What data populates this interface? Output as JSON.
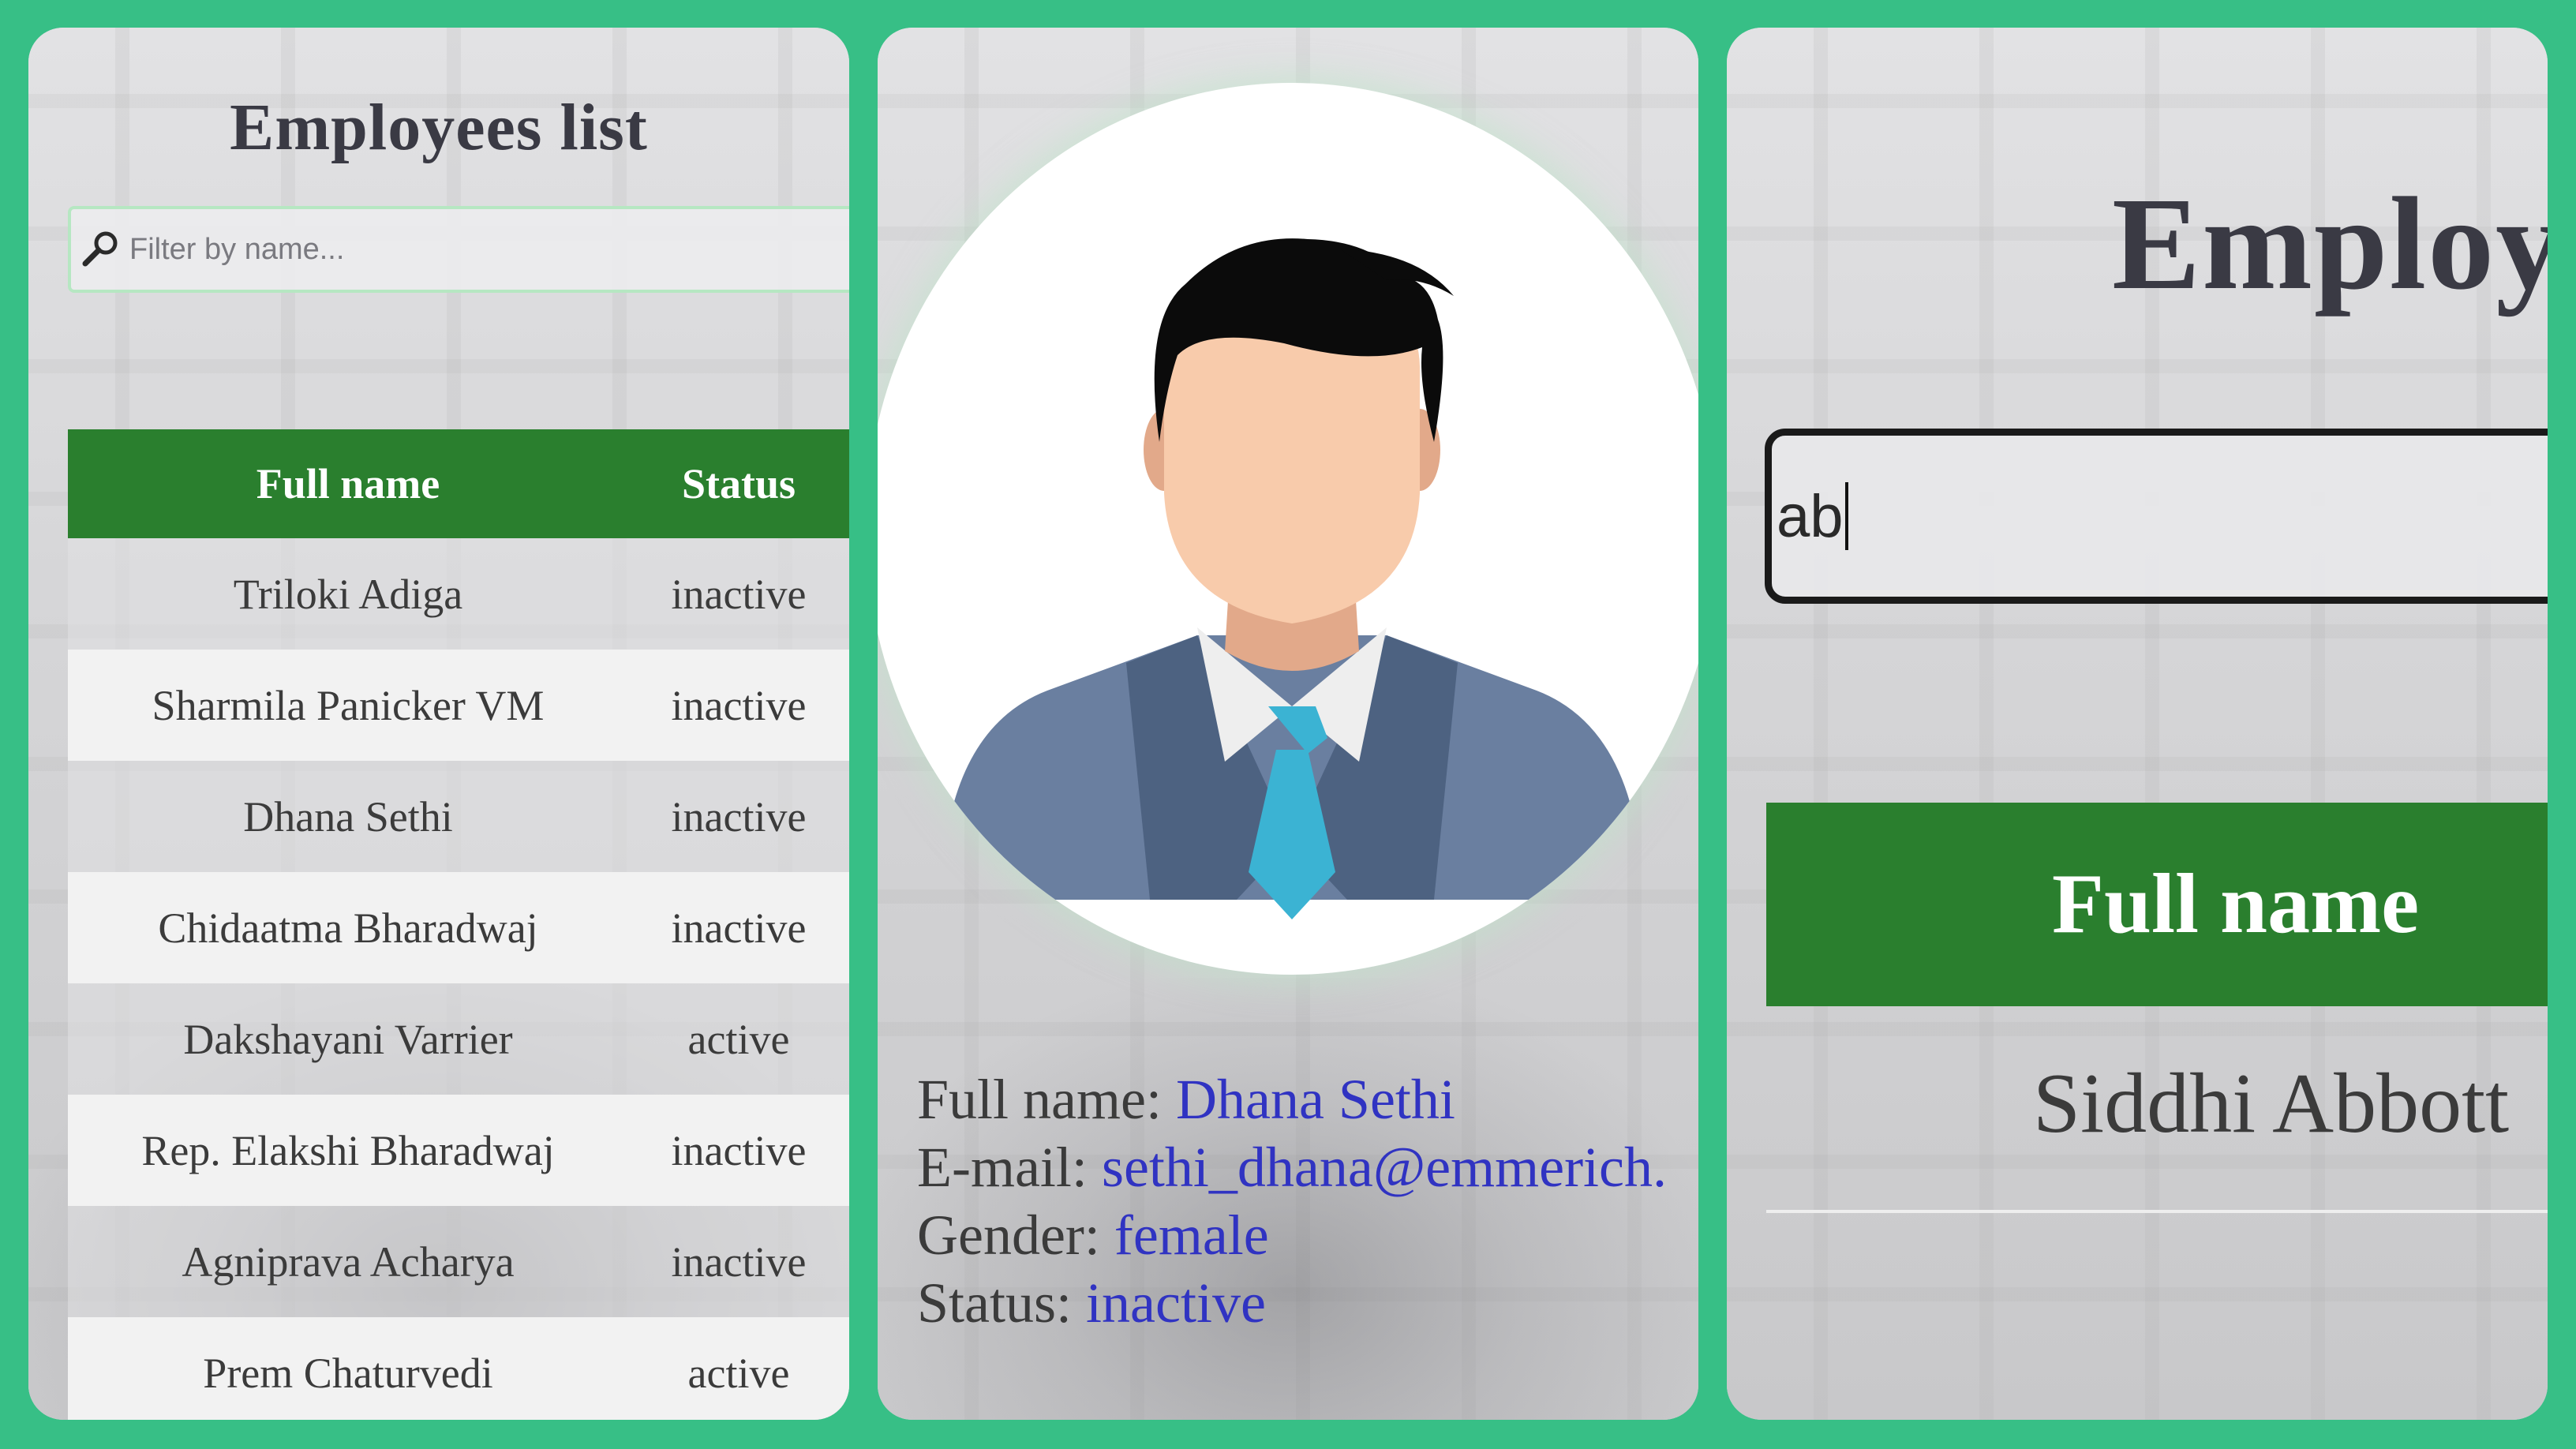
{
  "panel_left": {
    "title": "Employees list",
    "search": {
      "placeholder": "Filter by name..."
    },
    "table": {
      "headers": {
        "name": "Full name",
        "status": "Status"
      },
      "rows": [
        {
          "name": "Triloki Adiga",
          "status": "inactive"
        },
        {
          "name": "Sharmila Panicker VM",
          "status": "inactive"
        },
        {
          "name": "Dhana Sethi",
          "status": "inactive"
        },
        {
          "name": "Chidaatma Bharadwaj",
          "status": "inactive"
        },
        {
          "name": "Dakshayani Varrier",
          "status": "active"
        },
        {
          "name": "Rep. Elakshi Bharadwaj",
          "status": "inactive"
        },
        {
          "name": "Agniprava Acharya",
          "status": "inactive"
        },
        {
          "name": "Prem Chaturvedi",
          "status": "active"
        }
      ]
    }
  },
  "panel_middle": {
    "avatar_icon": "person-avatar-icon",
    "details": {
      "full_name_label": "Full name:",
      "full_name": "Dhana Sethi",
      "email_label": "E-mail:",
      "email": "sethi_dhana@emmerich.",
      "gender_label": "Gender:",
      "gender": "female",
      "status_label": "Status:",
      "status": "inactive"
    }
  },
  "panel_right": {
    "title_partial": "Employ",
    "search_value": "ab",
    "header_name": "Full name",
    "rows": [
      {
        "name": "Siddhi Abbott"
      }
    ]
  },
  "colors": {
    "frame_background": "#37bf86",
    "table_header": "#2a7f2e",
    "link_value": "#3033c2"
  }
}
